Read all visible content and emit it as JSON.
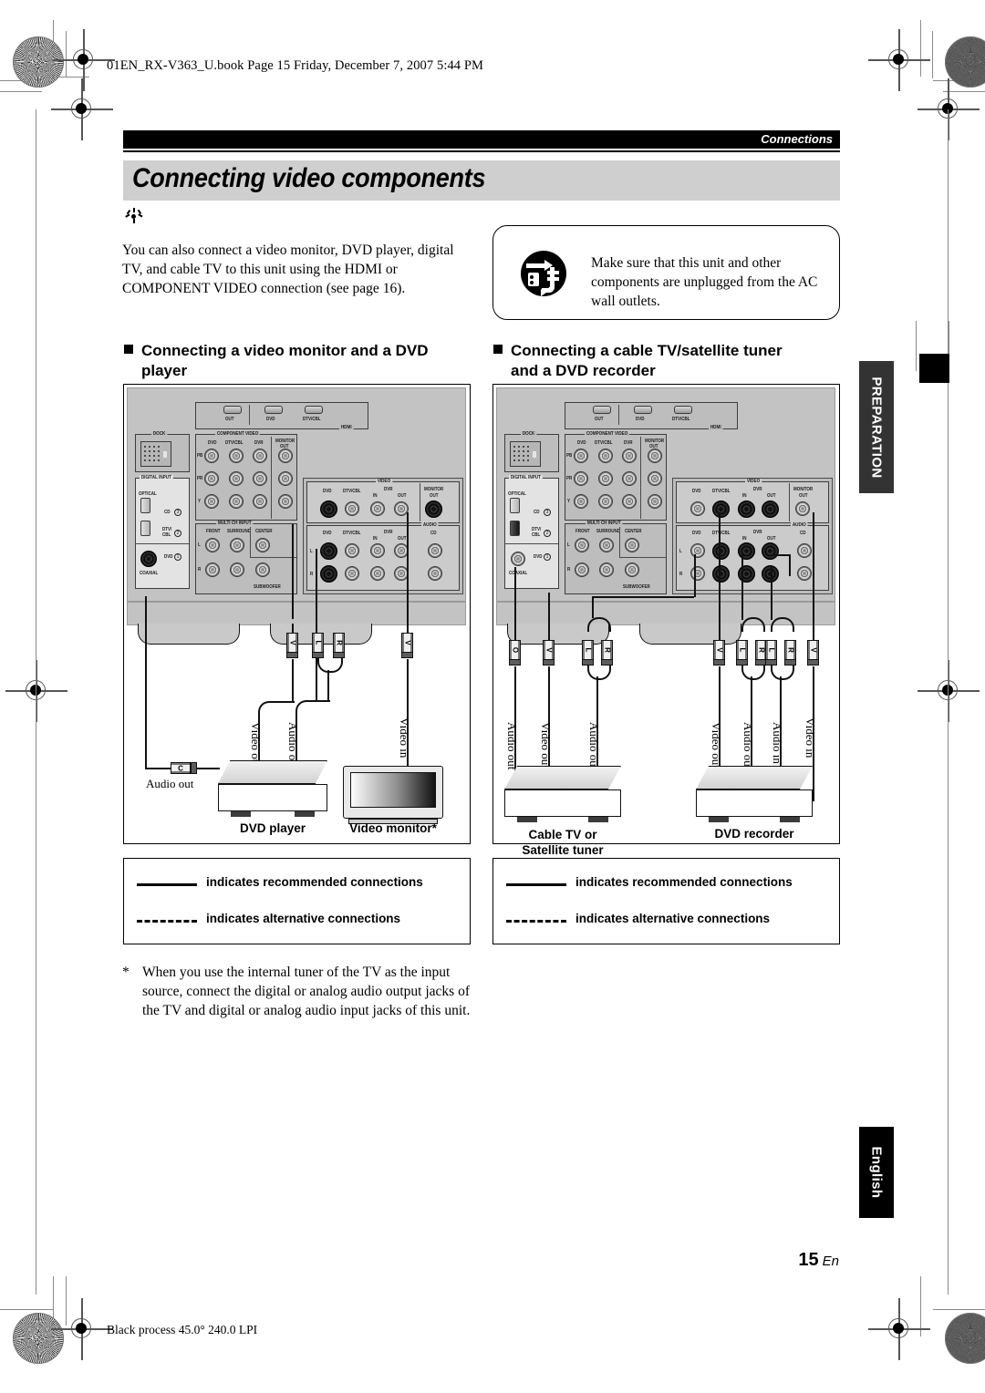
{
  "print": {
    "file_stamp": "01EN_RX-V363_U.book  Page 15  Friday, December 7, 2007  5:44 PM",
    "bottom_stamp": "Black process 45.0° 240.0 LPI"
  },
  "running_head": "Connections",
  "page_title": "Connecting video components",
  "intro": "You can also connect a video monitor, DVD player, digital TV, and cable TV to this unit using the HDMI or COMPONENT VIDEO connection (see page 16).",
  "warning": {
    "icon": "unplug-power-icon",
    "text": "Make sure that this unit and other components are unplugged from the AC wall outlets."
  },
  "sections": {
    "left": {
      "line1": "Connecting a video monitor and a DVD",
      "line2": "player"
    },
    "right": {
      "line1": "Connecting a cable TV/satellite tuner",
      "line2": "and a DVD recorder"
    }
  },
  "panel": {
    "groups": {
      "dock": "DOCK",
      "component_video": "COMPONENT VIDEO",
      "digital_input": "DIGITAL INPUT",
      "multi_ch_input": "MULTI CH INPUT",
      "video": "VIDEO",
      "audio": "AUDIO",
      "hdmi": "HDMI"
    },
    "component_video_cols": [
      "DVD",
      "DTV/CBL",
      "DVR",
      "MONITOR OUT"
    ],
    "component_video_rows": [
      "PB",
      "PR",
      "Y"
    ],
    "digital_input": {
      "optical": "OPTICAL",
      "coaxial": "COAXIAL",
      "items": [
        {
          "label": "CD",
          "num": "3"
        },
        {
          "label": "DTV/ CBL",
          "num": "2"
        },
        {
          "label": "DVD",
          "num": "1"
        }
      ]
    },
    "multi_ch_cols": [
      "FRONT",
      "SURROUND",
      "CENTER"
    ],
    "multi_ch_sub": "SUBWOOFER",
    "multi_ch_rows": [
      "L",
      "R"
    ],
    "video_cols": [
      "DVD",
      "DTV/CBL",
      "DVR",
      "MONITOR OUT"
    ],
    "video_sub": [
      "IN",
      "OUT"
    ],
    "audio_cols": [
      "DVD",
      "DTV/CBL",
      "DVR",
      "CD"
    ],
    "audio_sub": [
      "IN",
      "OUT"
    ],
    "audio_rows": [
      "L",
      "R"
    ],
    "hdmi_cols": [
      "OUT",
      "DVD",
      "DTV/CBL"
    ]
  },
  "diagram_left": {
    "plugs": [
      {
        "id": "dvd-video-out",
        "label": "V"
      },
      {
        "id": "dvd-audio-out-l",
        "label": "L"
      },
      {
        "id": "dvd-audio-out-r",
        "label": "R"
      },
      {
        "id": "monitor-video-in",
        "label": "V"
      },
      {
        "id": "dvd-coaxial-audio-out",
        "label": "C"
      }
    ],
    "cable_labels": [
      "Video out",
      "Audio out",
      "Video in",
      "Audio out"
    ],
    "devices": [
      {
        "id": "dvd-player",
        "label": "DVD player"
      },
      {
        "id": "video-monitor",
        "label": "Video monitor*"
      }
    ]
  },
  "diagram_right": {
    "plugs": [
      {
        "id": "cabletv-optical-out",
        "label": "O"
      },
      {
        "id": "cabletv-video-out",
        "label": "V"
      },
      {
        "id": "cabletv-audio-out-l",
        "label": "L"
      },
      {
        "id": "cabletv-audio-out-r",
        "label": "R"
      },
      {
        "id": "dvdrec-video-out",
        "label": "V"
      },
      {
        "id": "dvdrec-audio-out-l",
        "label": "L"
      },
      {
        "id": "dvdrec-audio-out-r",
        "label": "R"
      },
      {
        "id": "dvdrec-audio-in-l",
        "label": "L"
      },
      {
        "id": "dvdrec-audio-in-r",
        "label": "R"
      },
      {
        "id": "dvdrec-video-in",
        "label": "V"
      }
    ],
    "cable_labels": [
      "Audio out",
      "Video out",
      "Audio out",
      "Video out",
      "Audio out",
      "Audio in",
      "Video in"
    ],
    "devices": [
      {
        "id": "cable-tv-tuner",
        "line1": "Cable TV or",
        "line2": "Satellite tuner"
      },
      {
        "id": "dvd-recorder",
        "label": "DVD recorder"
      }
    ]
  },
  "legend": {
    "recommended": "indicates recommended connections",
    "alternative": "indicates alternative connections"
  },
  "footnote": {
    "marker": "*",
    "text": "When you use the internal tuner of the TV as the input source, connect the digital or analog audio output jacks of the TV and digital or analog audio input jacks of this unit."
  },
  "tabs": {
    "preparation": "PREPARATION",
    "english": "English"
  },
  "page_number": {
    "number": "15",
    "suffix": "En"
  }
}
